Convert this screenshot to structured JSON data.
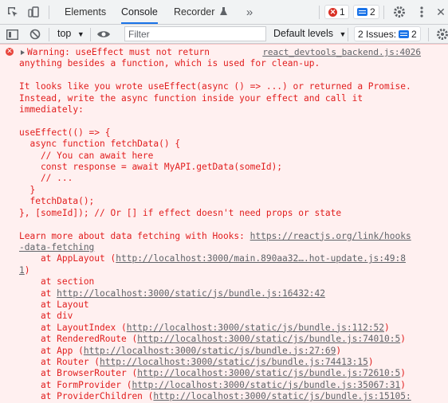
{
  "tabs": {
    "elements": "Elements",
    "console": "Console",
    "recorder": "Recorder",
    "errors_count": "1",
    "messages_count": "2"
  },
  "toolbar": {
    "context": "top",
    "filter_placeholder": "Filter",
    "levels": "Default levels",
    "issues_label": "2 Issues:",
    "issues_count": "2"
  },
  "console": {
    "source_link": "react_devtools_backend.js:4026",
    "warning_first": "Warning: useEffect must not return",
    "lines": [
      "anything besides a function, which is used for clean-up.",
      "",
      "It looks like you wrote useEffect(async () => ...) or returned a Promise.",
      "Instead, write the async function inside your effect and call it",
      "immediately:",
      "",
      "useEffect(() => {",
      "  async function fetchData() {",
      "    // You can await here",
      "    const response = await MyAPI.getData(someId);",
      "    // ...",
      "  }",
      "  fetchData();",
      "}, [someId]); // Or [] if effect doesn't need props or state",
      ""
    ],
    "learn_more": "Learn more about data fetching with Hooks: ",
    "learn_more_link_1": "https://reactjs.org/link/hooks",
    "learn_more_link_2": "-data-fetching",
    "stack": [
      {
        "prefix": "    at AppLayout (",
        "link": "http://localhost:3000/main.890aa32….hot-update.js:49:8",
        "suffix": ""
      },
      {
        "prefix": "",
        "link": "1",
        "suffix": ")"
      },
      {
        "prefix": "    at section",
        "link": "",
        "suffix": ""
      },
      {
        "prefix": "    at ",
        "link": "http://localhost:3000/static/js/bundle.js:16432:42",
        "suffix": ""
      },
      {
        "prefix": "    at Layout",
        "link": "",
        "suffix": ""
      },
      {
        "prefix": "    at div",
        "link": "",
        "suffix": ""
      },
      {
        "prefix": "    at LayoutIndex (",
        "link": "http://localhost:3000/static/js/bundle.js:112:52",
        "suffix": ")"
      },
      {
        "prefix": "    at RenderedRoute (",
        "link": "http://localhost:3000/static/js/bundle.js:74010:5",
        "suffix": ")"
      },
      {
        "prefix": "    at App (",
        "link": "http://localhost:3000/static/js/bundle.js:27:69",
        "suffix": ")"
      },
      {
        "prefix": "    at Router (",
        "link": "http://localhost:3000/static/js/bundle.js:74413:15",
        "suffix": ")"
      },
      {
        "prefix": "    at BrowserRouter (",
        "link": "http://localhost:3000/static/js/bundle.js:72610:5",
        "suffix": ")"
      },
      {
        "prefix": "    at FormProvider (",
        "link": "http://localhost:3000/static/js/bundle.js:35067:31",
        "suffix": ")"
      },
      {
        "prefix": "    at ProviderChildren (",
        "link": "http://localhost:3000/static/js/bundle.js:15105:",
        "suffix": ""
      }
    ]
  }
}
